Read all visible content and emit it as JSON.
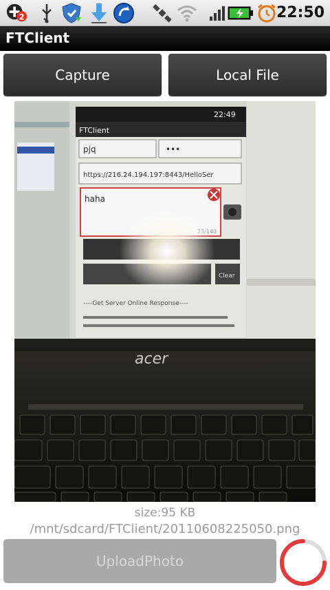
{
  "statusbar": {
    "badge_count": "2",
    "time": "22:50",
    "icons": [
      "notification-badge-icon",
      "usb-icon",
      "shield-update-icon",
      "download-icon",
      "sync-app-icon",
      "gps-icon",
      "wifi-icon",
      "signal-icon",
      "battery-charging-icon",
      "alarm-icon"
    ]
  },
  "app": {
    "title": "FTClient"
  },
  "buttons": {
    "capture": "Capture",
    "local_file": "Local File",
    "upload": "UploadPhoto"
  },
  "photo": {
    "inner_title": "FTClient",
    "inner_time": "22:49",
    "inner_user": "pjq",
    "inner_pass": "•••",
    "inner_url": "https://216.24.194.197:8443/HelloSer",
    "inner_text": "haha",
    "inner_counter": "23/140",
    "inner_clear": "Clear",
    "inner_response": "----Get Server Online Response----",
    "inner_brand": "acer"
  },
  "file_info": {
    "size": "size:95 KB",
    "path": "/mnt/sdcard/FTClient/20110608225050.png"
  },
  "colors": {
    "spinner": "#e33b3b",
    "titlebar": "#000000",
    "button": "#3a3a3a"
  }
}
